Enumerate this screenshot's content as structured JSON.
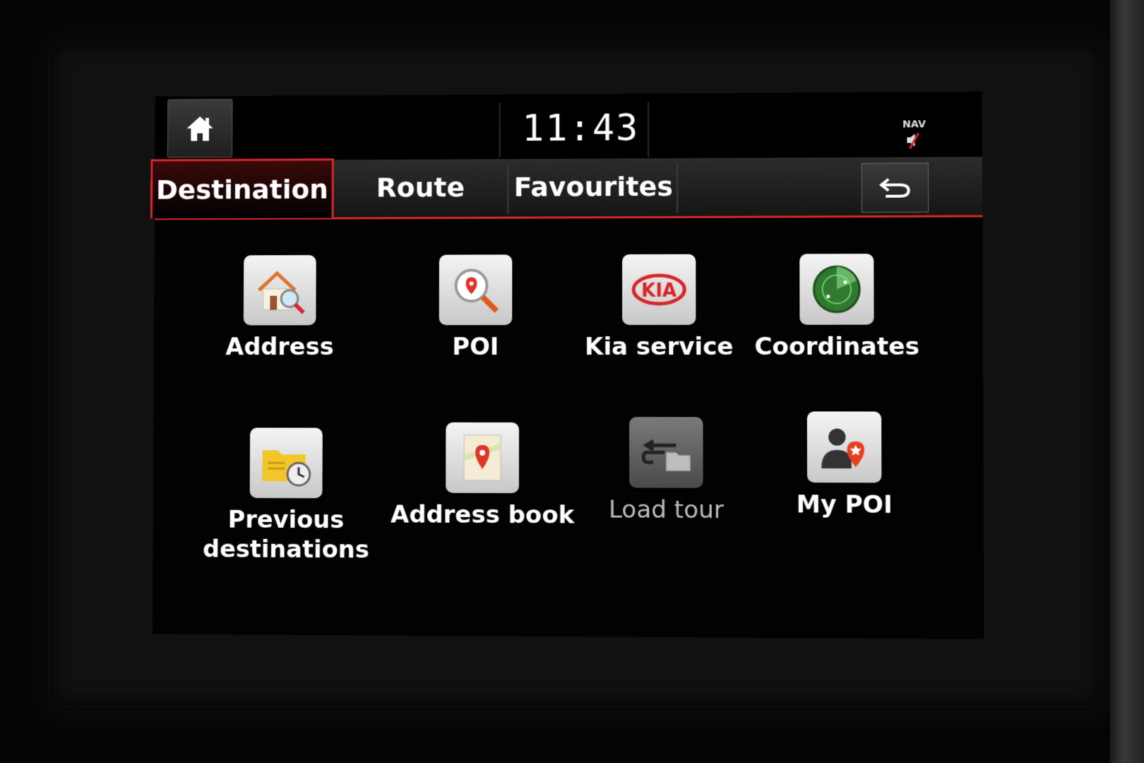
{
  "statusbar": {
    "time": "11:43",
    "nav_label": "NAV",
    "home_icon": "home-icon",
    "mute_icon": "speaker-muted-icon"
  },
  "tabs": [
    {
      "label": "Destination",
      "active": true
    },
    {
      "label": "Route",
      "active": false
    },
    {
      "label": "Favourites",
      "active": false
    }
  ],
  "back_icon": "back-arrow-icon",
  "accent_color": "#d8262a",
  "menu": [
    {
      "label": "Address",
      "icon": "house-search-icon"
    },
    {
      "label": "POI",
      "icon": "poi-search-icon"
    },
    {
      "label": "Kia service",
      "icon": "kia-logo-icon"
    },
    {
      "label": "Coordinates",
      "icon": "radar-globe-icon"
    },
    {
      "label": "Previous destinations",
      "icon": "folder-clock-icon"
    },
    {
      "label": "Address book",
      "icon": "map-pin-book-icon"
    },
    {
      "label": "Load tour",
      "icon": "tour-folder-icon",
      "enabled": false
    },
    {
      "label": "My POI",
      "icon": "person-star-icon"
    }
  ]
}
